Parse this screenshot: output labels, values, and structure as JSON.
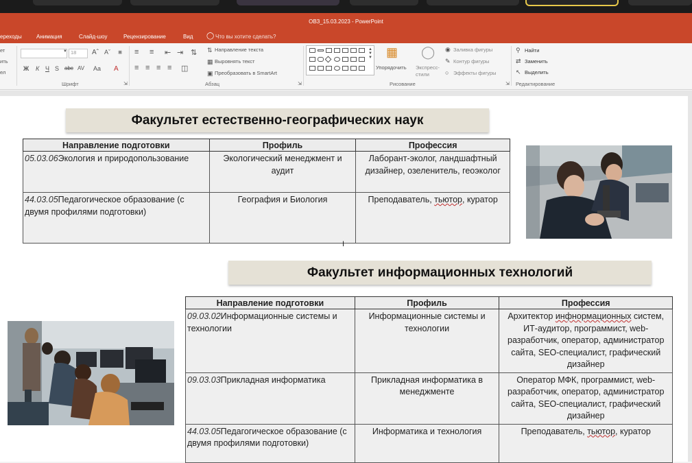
{
  "window": {
    "title": "ОВЗ_15.03.2023 - PowerPoint"
  },
  "menu": [
    "ереходы",
    "Анимация",
    "Слайд-шоу",
    "Рецензирование",
    "Вид",
    "Что вы хотите сделать?"
  ],
  "ribbon": {
    "font_group_label": "Шрифт",
    "paragraph_group_label": "Абзац",
    "drawing_group_label": "Рисование",
    "editing_group_label": "Редактирование",
    "font_size": "18",
    "left_cut": [
      "ет",
      "ить",
      "ел"
    ],
    "text_direction": "Направление текста",
    "align_text": "Выровнять текст",
    "convert_smartart": "Преобразовать в SmartArt",
    "arrange": "Упорядочить",
    "quick_styles": "Экспресс-стили",
    "shape_fill": "Заливка фигуры",
    "shape_outline": "Контур фигуры",
    "shape_effects": "Эффекты фигуры",
    "find": "Найти",
    "replace": "Заменить",
    "select": "Выделить",
    "font_buttons": [
      "Ж",
      "К",
      "Ч",
      "S",
      "abc",
      "AV",
      "Aa",
      "A"
    ]
  },
  "slide": {
    "section1": {
      "title": "Факультет естественно-географических наук",
      "headers": [
        "Направление подготовки",
        "Профиль",
        "Профессия"
      ],
      "rows": [
        {
          "code": "05.03.06",
          "direction": "Экология и природопользование",
          "profile": "Экологический менеджмент и аудит",
          "profession": "Лаборант-эколог, ландшафтный дизайнер, озеленитель, геоэколог"
        },
        {
          "code": "44.03.05",
          "direction": "Педагогическое образование (с двумя профилями подготовки)",
          "profile": "География и Биология",
          "profession_a": "Преподаватель, ",
          "profession_u": "тьютор",
          "profession_b": ", куратор"
        }
      ]
    },
    "section2": {
      "title": "Факультет информационных технологий",
      "headers": [
        "Направление подготовки",
        "Профиль",
        "Профессия"
      ],
      "rows": [
        {
          "code": "09.03.02",
          "direction": "Информационные системы и технологии",
          "profile": "Информационные системы и технологии",
          "profession_a": "Архитектор ",
          "profession_u": "инфнормационных",
          "profession_b": " систем, ИТ-аудитор, программист, web-разработчик, оператор, администратор сайта, SEO-специалист, графический дизайнер"
        },
        {
          "code": "09.03.03",
          "direction": "Прикладная информатика",
          "profile": "Прикладная информатика в менеджменте",
          "profession": "Оператор МФК, программист, web-разработчик, оператор, администратор сайта, SEO-специалист, графический дизайнер"
        },
        {
          "code": "44.03.05",
          "direction": "Педагогическое образование (с двумя профилями подготовки)",
          "profile": "Информатика и технология",
          "profession_a": "Преподаватель, ",
          "profession_u": "тьютор",
          "profession_b": ", куратор"
        }
      ]
    }
  }
}
